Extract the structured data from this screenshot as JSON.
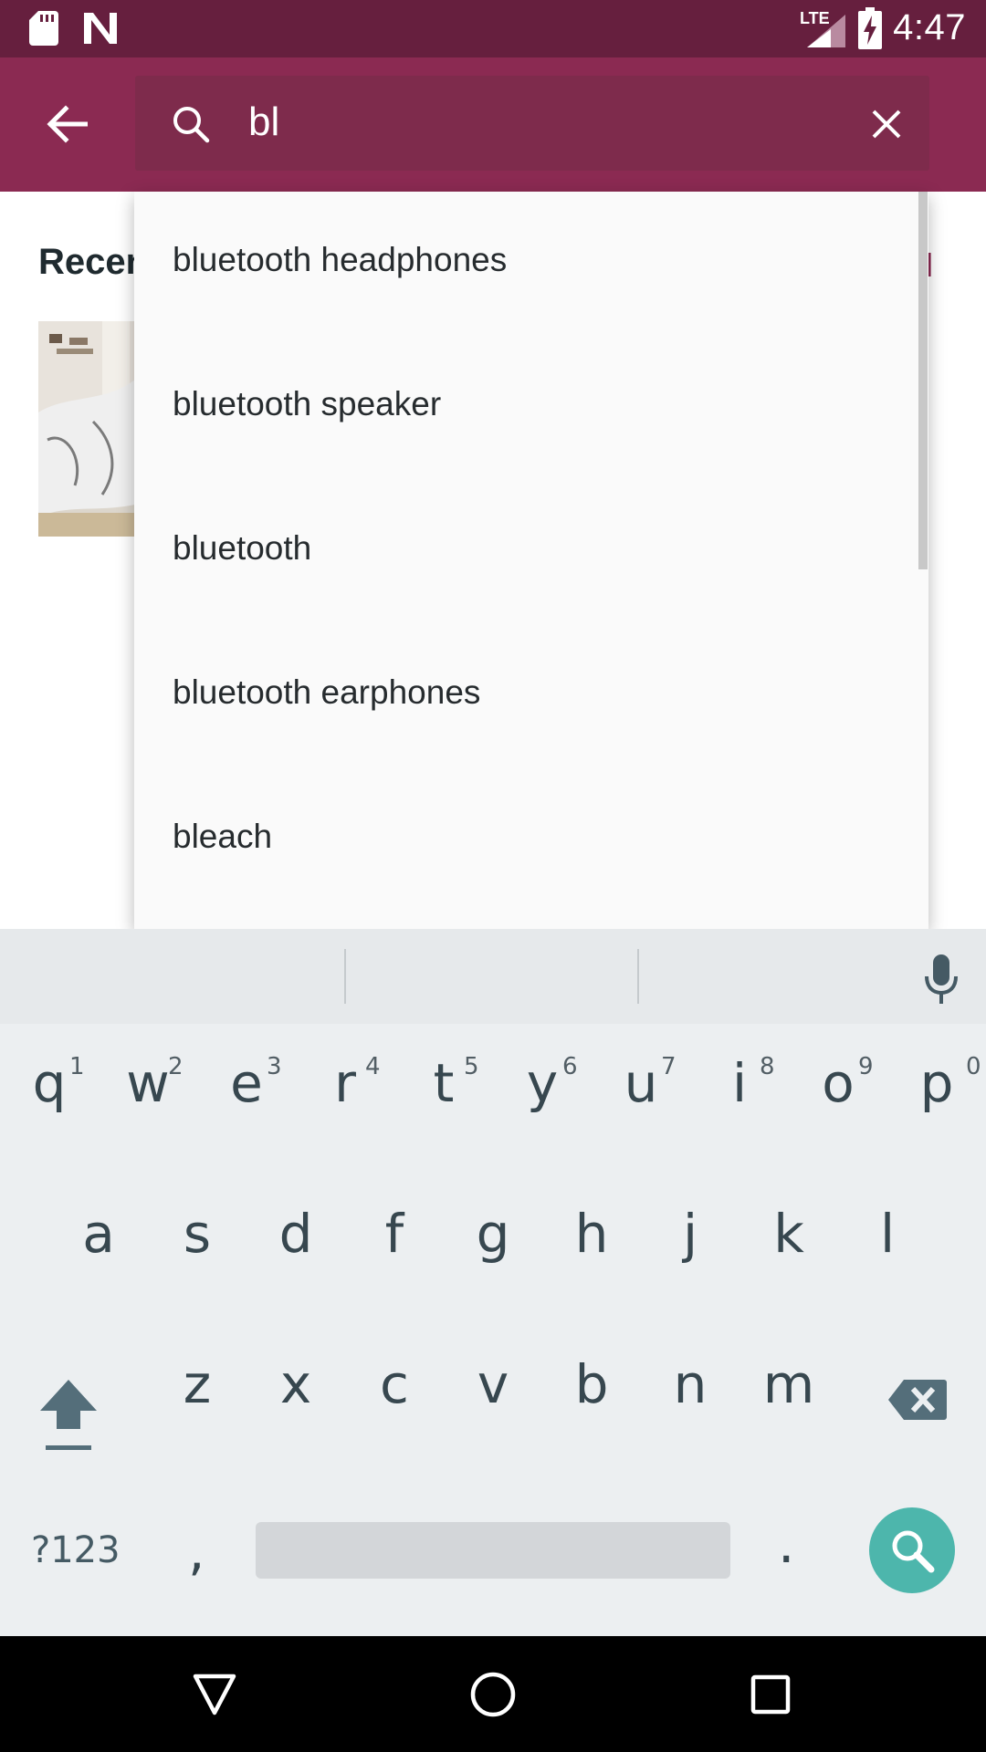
{
  "status_bar": {
    "time": "4:47",
    "network": "LTE"
  },
  "search": {
    "query": "bl"
  },
  "recent": {
    "title": "Recen",
    "see_all": "ll"
  },
  "suggestions": [
    "bluetooth headphones",
    "bluetooth speaker",
    "bluetooth",
    "bluetooth earphones",
    "bleach"
  ],
  "keyboard": {
    "row1": [
      "q",
      "w",
      "e",
      "r",
      "t",
      "y",
      "u",
      "i",
      "o",
      "p"
    ],
    "row1_numbers": [
      "1",
      "2",
      "3",
      "4",
      "5",
      "6",
      "7",
      "8",
      "9",
      "0"
    ],
    "row2": [
      "a",
      "s",
      "d",
      "f",
      "g",
      "h",
      "j",
      "k",
      "l"
    ],
    "row3": [
      "z",
      "x",
      "c",
      "v",
      "b",
      "n",
      "m"
    ],
    "symbols_key": "?123",
    "comma": ",",
    "period": "."
  },
  "colors": {
    "status_bar": "#661f3e",
    "app_bar": "#8b2a52",
    "search_field": "#7e2b4c",
    "search_fab": "#4db6ac",
    "keyboard_bg": "#eceff1"
  },
  "icons": [
    "sd-card-icon",
    "n-logo-icon",
    "signal-icon",
    "battery-charging-icon",
    "back-arrow-icon",
    "search-icon",
    "clear-icon",
    "microphone-icon",
    "shift-icon",
    "backspace-icon",
    "keyboard-search-icon",
    "nav-back-icon",
    "nav-home-icon",
    "nav-recents-icon"
  ]
}
